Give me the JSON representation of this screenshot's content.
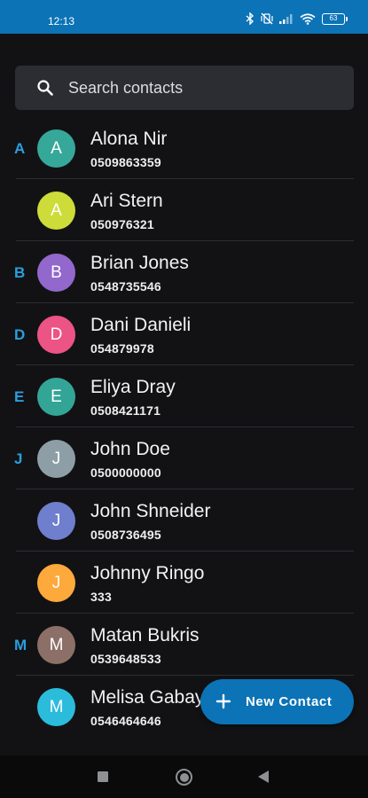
{
  "status_bar": {
    "time": "12:13",
    "battery_level": "63",
    "icons": [
      "bluetooth-icon",
      "vibrate-off-icon",
      "signal-icon",
      "wifi-icon",
      "battery-icon"
    ]
  },
  "search": {
    "placeholder": "Search contacts",
    "icon": "search-icon"
  },
  "contacts": [
    {
      "section": "A",
      "initial": "A",
      "name": "Alona Nir",
      "phone": "0509863359",
      "avatar_color": "#36a899"
    },
    {
      "section": "",
      "initial": "A",
      "name": "Ari Stern",
      "phone": "050976321",
      "avatar_color": "#cddc39"
    },
    {
      "section": "B",
      "initial": "B",
      "name": "Brian Jones",
      "phone": "0548735546",
      "avatar_color": "#9268cc"
    },
    {
      "section": "D",
      "initial": "D",
      "name": "Dani Danieli",
      "phone": "054879978",
      "avatar_color": "#ec5485"
    },
    {
      "section": "E",
      "initial": "E",
      "name": "Eliya Dray",
      "phone": "0508421171",
      "avatar_color": "#33a596"
    },
    {
      "section": "J",
      "initial": "J",
      "name": "John Doe",
      "phone": "0500000000",
      "avatar_color": "#8d9ea6"
    },
    {
      "section": "",
      "initial": "J",
      "name": "John Shneider",
      "phone": "0508736495",
      "avatar_color": "#6f7fcd"
    },
    {
      "section": "",
      "initial": "J",
      "name": "Johnny Ringo",
      "phone": "333",
      "avatar_color": "#fda93b"
    },
    {
      "section": "M",
      "initial": "M",
      "name": "Matan Bukris",
      "phone": "0539648533",
      "avatar_color": "#8c7068"
    },
    {
      "section": "",
      "initial": "M",
      "name": "Melisa Gabay",
      "phone": "0546464646",
      "avatar_color": "#2bbcdc"
    }
  ],
  "fab": {
    "label": "New Contact",
    "icon": "plus-icon"
  },
  "colors": {
    "accent": "#0b73b6",
    "section_letter": "#2a9fdd",
    "background": "#121214"
  },
  "nav_bar": {
    "icons": [
      "recents-icon",
      "home-icon",
      "back-icon"
    ]
  }
}
